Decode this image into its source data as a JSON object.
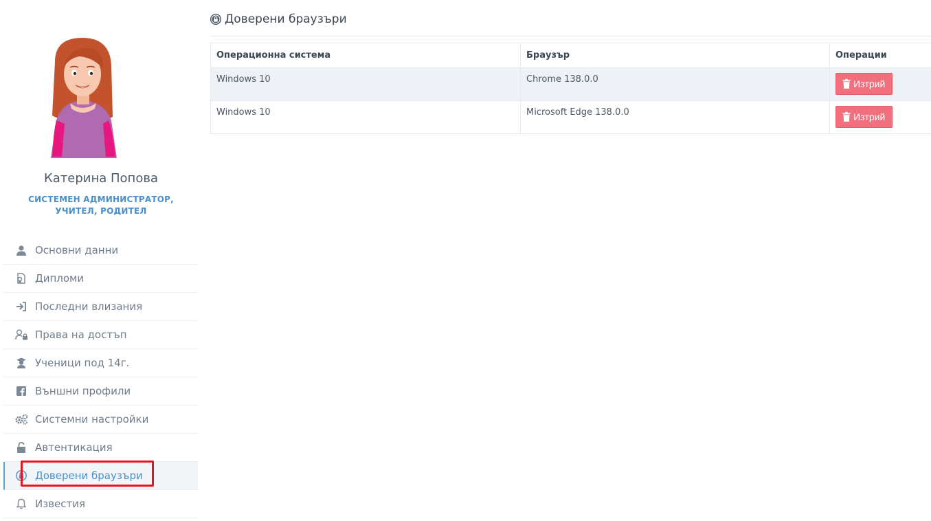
{
  "profile": {
    "name": "Катерина Попова",
    "roles": "СИСТЕМЕН АДМИНИСТРАТОР, УЧИТЕЛ, РОДИТЕЛ"
  },
  "sidebar": {
    "items": [
      {
        "label": "Основни данни",
        "icon": "user-icon"
      },
      {
        "label": "Дипломи",
        "icon": "diploma-icon"
      },
      {
        "label": "Последни влизания",
        "icon": "sign-in-icon"
      },
      {
        "label": "Права на достъп",
        "icon": "user-lock-icon"
      },
      {
        "label": "Ученици под 14г.",
        "icon": "graduate-icon"
      },
      {
        "label": "Външни профили",
        "icon": "facebook-icon"
      },
      {
        "label": "Системни настройки",
        "icon": "gears-icon"
      },
      {
        "label": "Автентикация",
        "icon": "unlock-icon"
      },
      {
        "label": "Доверени браузъри",
        "icon": "lock-circle-icon",
        "active": true
      },
      {
        "label": "Известия",
        "icon": "bell-icon"
      }
    ]
  },
  "main": {
    "title": "Доверени браузъри",
    "table": {
      "headers": [
        "Операционна система",
        "Браузър",
        "Операции"
      ],
      "rows": [
        {
          "os": "Windows 10",
          "browser": "Chrome 138.0.0",
          "action": "Изтрий"
        },
        {
          "os": "Windows 10",
          "browser": "Microsoft Edge 138.0.0",
          "action": "Изтрий"
        }
      ]
    }
  },
  "colors": {
    "accent": "#4a8fc9",
    "delete_button": "#f0707e",
    "highlight": "#e8141c"
  }
}
